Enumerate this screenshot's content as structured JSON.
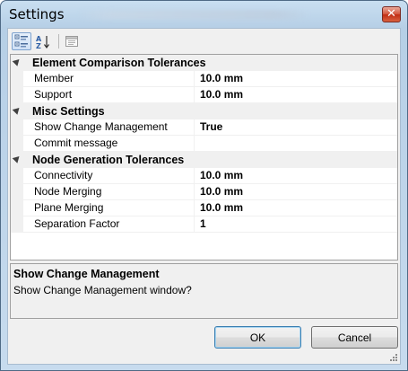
{
  "window": {
    "title": "Settings",
    "close_glyph": "✕"
  },
  "toolbar": {
    "buttons": [
      {
        "icon": "categorized-icon",
        "active": true
      },
      {
        "icon": "sort-alphabetical-icon",
        "active": false
      },
      {
        "icon": "property-pages-icon",
        "active": false
      }
    ]
  },
  "grid": {
    "categories": [
      {
        "label": "Element Comparison Tolerances",
        "properties": [
          {
            "name": "Member",
            "value": "10.0 mm"
          },
          {
            "name": "Support",
            "value": "10.0 mm"
          }
        ]
      },
      {
        "label": "Misc Settings",
        "properties": [
          {
            "name": "Show Change Management",
            "value": "True"
          },
          {
            "name": "Commit message",
            "value": ""
          }
        ]
      },
      {
        "label": "Node Generation Tolerances",
        "properties": [
          {
            "name": "Connectivity",
            "value": "10.0 mm"
          },
          {
            "name": "Node Merging",
            "value": "10.0 mm"
          },
          {
            "name": "Plane Merging",
            "value": "10.0 mm"
          },
          {
            "name": "Separation Factor",
            "value": "1"
          }
        ]
      }
    ]
  },
  "description": {
    "title": "Show Change Management",
    "text": "Show Change Management window?"
  },
  "buttons": {
    "ok_label": "OK",
    "cancel_label": "Cancel"
  },
  "colors": {
    "title_gradient_top": "#c9dff1",
    "close_red": "#c02d14",
    "grid_line": "#f0f0f0"
  }
}
